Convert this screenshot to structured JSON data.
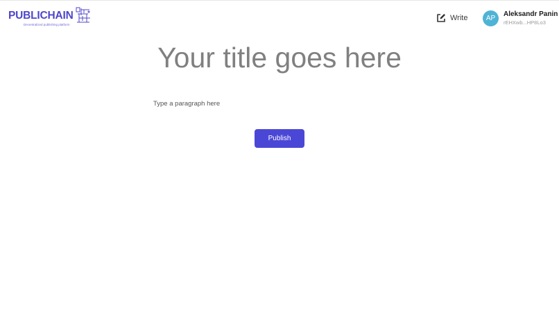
{
  "brand": {
    "name": "PUBLICHAIN",
    "tagline": "Decentralized publishing platform",
    "logo_icon": "publichain-mark-icon",
    "color": "#4f46c9"
  },
  "header": {
    "write_label": "Write",
    "write_icon": "edit-icon"
  },
  "user": {
    "initials": "AP",
    "name": "Aleksandr Panin",
    "address": "rEHXwb...HP8Lo3",
    "avatar_color": "#4fb3d6"
  },
  "editor": {
    "title_placeholder": "Your title goes here",
    "paragraph_placeholder": "Type a paragraph here",
    "publish_label": "Publish",
    "publish_color": "#4b47d6"
  }
}
